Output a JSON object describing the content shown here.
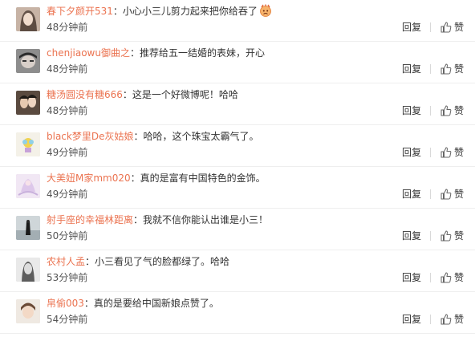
{
  "comments": [
    {
      "user": "春下夕颜开531",
      "text": "小心小三儿剪力起来把你给吞了",
      "time": "48分钟前",
      "reply": "回复",
      "like": "赞",
      "emoji": "angry-face-emoji"
    },
    {
      "user": "chenjiaowu御曲之",
      "text": "推荐给五一结婚的表妹，开心",
      "time": "48分钟前",
      "reply": "回复",
      "like": "赞"
    },
    {
      "user": "糖汤圆没有糖666",
      "text": "这是一个好微博呢！哈哈",
      "time": "48分钟前",
      "reply": "回复",
      "like": "赞"
    },
    {
      "user": "black梦里De灰姑娘",
      "text": "哈哈，这个珠宝太霸气了。",
      "time": "49分钟前",
      "reply": "回复",
      "like": "赞"
    },
    {
      "user": "大美妞M家mm020",
      "text": "真的是富有中国特色的金饰。",
      "time": "49分钟前",
      "reply": "回复",
      "like": "赞"
    },
    {
      "user": "射手座的幸福林距离",
      "text": "我就不信你能认出谁是小三！",
      "time": "50分钟前",
      "reply": "回复",
      "like": "赞"
    },
    {
      "user": "农村人孟",
      "text": "小三看见了气的脸都绿了。哈哈",
      "time": "53分钟前",
      "reply": "回复",
      "like": "赞"
    },
    {
      "user": "帛偷003",
      "text": "真的是要给中国新娘点赞了。",
      "time": "54分钟前",
      "reply": "回复",
      "like": "赞"
    }
  ],
  "colors": {
    "username": "#eb7350",
    "username_alt": "#4c7bb2",
    "text": "#333333",
    "time": "#555555"
  },
  "separator": "："
}
